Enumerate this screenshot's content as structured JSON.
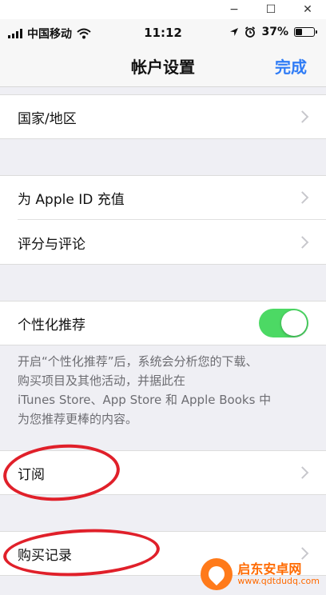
{
  "window_controls": {
    "minimize": "−",
    "maximize": "☐",
    "close": "✕"
  },
  "status_bar": {
    "carrier": "中国移动",
    "time": "11:12",
    "battery_percent": "37%",
    "battery_level": 0.37,
    "icons": [
      "signal-icon",
      "wifi-icon",
      "location-icon",
      "alarm-icon",
      "battery-icon"
    ]
  },
  "nav": {
    "title": "帐户设置",
    "done": "完成"
  },
  "cells": {
    "country": "国家/地区",
    "recharge": "为 Apple ID 充值",
    "ratings": "评分与评论",
    "personalized": "个性化推荐",
    "subscriptions": "订阅",
    "purchase_history": "购买记录"
  },
  "personalized_toggle": {
    "on": true,
    "color": "#4cd964"
  },
  "footer": {
    "line1": "开启“个性化推荐”后，系统会分析您的下载、",
    "line2": "购买项目及其他活动，并据此在",
    "line3": "iTunes Store、App Store 和 Apple Books 中",
    "line4": "为您推荐更棒的内容。"
  },
  "watermark": {
    "name": "启东安卓网",
    "url": "www.qdtdudq.com"
  },
  "colors": {
    "accent": "#2f7cf6",
    "annotation": "#e0202a",
    "background": "#efeff4"
  }
}
